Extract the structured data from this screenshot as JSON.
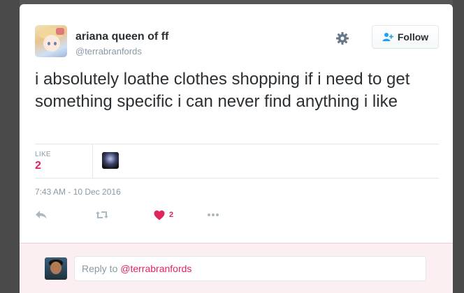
{
  "tweet": {
    "display_name": "ariana queen of ff",
    "handle": "@terrabranfords",
    "text": "i absolutely loathe clothes shopping if i need to get something specific i can never find anything i like",
    "likes_label": "LIKE",
    "likes_count": "2",
    "timestamp": "7:43 AM - 10 Dec 2016"
  },
  "header": {
    "follow_label": "Follow"
  },
  "actions": {
    "like_count": "2"
  },
  "reply": {
    "placeholder_prefix": "Reply to",
    "placeholder_handle": "@terrabranfords"
  },
  "icons": {
    "gear": "gear-icon",
    "follow": "add-user-icon",
    "reply": "reply-icon",
    "retweet": "retweet-icon",
    "like": "heart-icon",
    "more": "more-icon"
  },
  "colors": {
    "accent_like": "#e0245e",
    "text": "#292f33",
    "muted": "#8899a6",
    "reply_bg": "#fbeff2"
  }
}
